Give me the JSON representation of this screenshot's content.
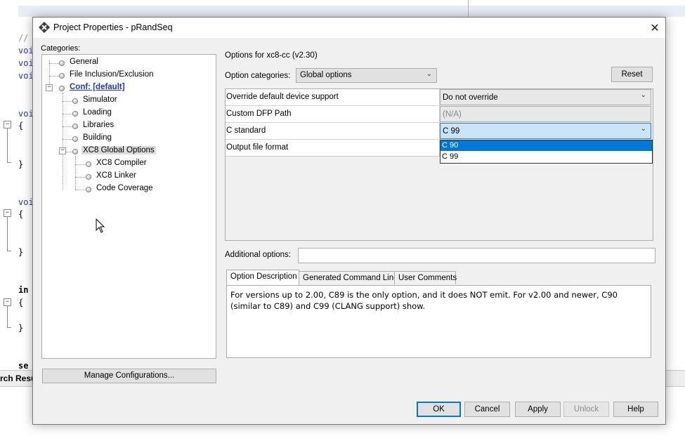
{
  "background_ide": {
    "code_lines": [
      {
        "text": "//",
        "style": "grey"
      },
      {
        "text": "voi",
        "style": "normal"
      },
      {
        "text": "voi",
        "style": "normal"
      },
      {
        "text": "voi",
        "style": "normal"
      },
      {
        "text": "voi",
        "style": "normal"
      },
      {
        "text": "{",
        "style": "brace"
      },
      {
        "text": "}",
        "style": "brace"
      },
      {
        "text": "voi",
        "style": "normal"
      },
      {
        "text": "{",
        "style": "brace"
      },
      {
        "text": "}",
        "style": "brace"
      },
      {
        "text": "in",
        "style": "bold"
      },
      {
        "text": "{",
        "style": "brace"
      },
      {
        "text": "}",
        "style": "brace"
      },
      {
        "text": "se",
        "style": "bold"
      }
    ],
    "output_tab_label": "rch Resu"
  },
  "dialog": {
    "title": "Project Properties - pRandSeq",
    "categories_label": "Categories:",
    "tree": [
      {
        "label": "General"
      },
      {
        "label": "File Inclusion/Exclusion"
      },
      {
        "label": "Conf: [default]"
      },
      {
        "label": "Simulator"
      },
      {
        "label": "Loading"
      },
      {
        "label": "Libraries"
      },
      {
        "label": "Building"
      },
      {
        "label": "XC8 Global Options"
      },
      {
        "label": "XC8 Compiler"
      },
      {
        "label": "XC8 Linker"
      },
      {
        "label": "Code Coverage"
      }
    ],
    "manage_button": "Manage Configurations...",
    "options_for": "Options for xc8-cc (v2.30)",
    "option_categories_label": "Option categories:",
    "option_categories_value": "Global options",
    "reset_button": "Reset",
    "properties": [
      {
        "name": "Override default device support",
        "value": "Do not override"
      },
      {
        "name": "Custom DFP Path",
        "value": "(N/A)"
      },
      {
        "name": "C standard",
        "value": "C 99"
      },
      {
        "name": "Output file format",
        "value": ""
      }
    ],
    "dropdown_options": [
      "C 90",
      "C 99"
    ],
    "additional_options_label": "Additional options:",
    "additional_options_value": "",
    "tabs": [
      "Option Description",
      "Generated Command Line",
      "User Comments"
    ],
    "description": "For versions up to 2.00, C89 is the only option, and it does NOT emit. For v2.00 and newer, C90 (similar to C89) and C99 (CLANG support) show.",
    "buttons": {
      "ok": "OK",
      "cancel": "Cancel",
      "apply": "Apply",
      "unlock": "Unlock",
      "help": "Help"
    }
  },
  "colors": {
    "selection": "#0078d7",
    "link": "#1f35c9",
    "active_combo": "#cce4f7"
  }
}
